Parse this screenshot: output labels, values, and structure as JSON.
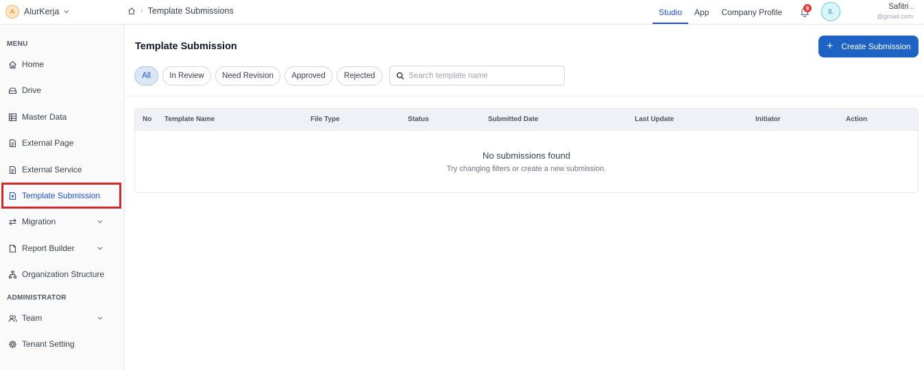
{
  "brand": {
    "initial": "A",
    "name": "AlurKerja"
  },
  "breadcrumb": {
    "current": "Template Submissions"
  },
  "topnav": {
    "tabs": [
      "Studio",
      "App",
      "Company Profile"
    ],
    "active": "Studio"
  },
  "notifications": {
    "count": "9"
  },
  "user": {
    "initial": "S.",
    "name": "Safitri .",
    "email": "@gmail.com"
  },
  "sidebar": {
    "menu_label": "MENU",
    "admin_label": "ADMINISTRATOR",
    "items": [
      {
        "label": "Home",
        "icon": "home-icon"
      },
      {
        "label": "Drive",
        "icon": "drive-icon"
      },
      {
        "label": "Master Data",
        "icon": "table-icon"
      },
      {
        "label": "External Page",
        "icon": "document-icon"
      },
      {
        "label": "External Service",
        "icon": "document-icon"
      },
      {
        "label": "Template Submission",
        "icon": "file-upload-icon",
        "active": true
      },
      {
        "label": "Migration",
        "icon": "arrows-icon"
      },
      {
        "label": "Report Builder",
        "icon": "file-icon"
      },
      {
        "label": "Organization Structure",
        "icon": "org-chart-icon"
      }
    ],
    "admin_items": [
      {
        "label": "Team",
        "icon": "users-icon"
      },
      {
        "label": "Tenant Setting",
        "icon": "gear-icon"
      }
    ]
  },
  "main": {
    "title": "Template Submission",
    "create_label": "Create Submission",
    "filters": [
      "All",
      "In Review",
      "Need Revision",
      "Approved",
      "Rejected"
    ],
    "active_filter": "All",
    "search_placeholder": "Search template name",
    "table": {
      "columns": [
        "No",
        "Template Name",
        "File Type",
        "Status",
        "Submitted Date",
        "Last Update",
        "Initiator",
        "Action"
      ],
      "rows": [],
      "empty_title": "No submissions found",
      "empty_subtitle": "Try changing filters or create a new submission."
    }
  },
  "colors": {
    "accent": "#1e63c4",
    "highlight": "#d62728",
    "badge": "#e53935"
  }
}
